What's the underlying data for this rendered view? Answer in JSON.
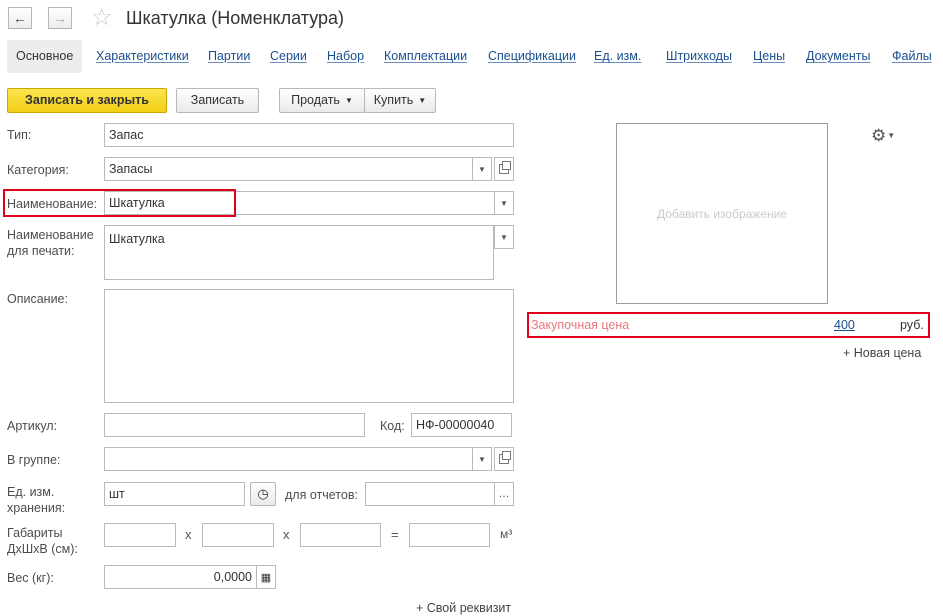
{
  "window": {
    "title": "Шкатулка (Номенклатура)"
  },
  "nav": {
    "back_icon": "←",
    "forward_icon": "→",
    "star_icon": "☆"
  },
  "tabs": [
    "Основное",
    "Характеристики",
    "Партии",
    "Серии",
    "Набор",
    "Комплектации",
    "Спецификации",
    "Ед. изм.",
    "Штрихкоды",
    "Цены",
    "Документы",
    "Файлы"
  ],
  "toolbar": {
    "save_close": "Записать и закрыть",
    "save": "Записать",
    "sell": "Продать",
    "buy": "Купить"
  },
  "form": {
    "type_label": "Тип:",
    "type_value": "Запас",
    "category_label": "Категория:",
    "category_value": "Запасы",
    "name_label": "Наименование:",
    "name_value": "Шкатулка",
    "print_name_label_1": "Наименование",
    "print_name_label_2": "для печати:",
    "print_name_value": "Шкатулка",
    "description_label": "Описание:",
    "description_value": "",
    "article_label": "Артикул:",
    "article_value": "",
    "code_label": "Код:",
    "code_value": "НФ-00000040",
    "group_label": "В группе:",
    "group_value": "",
    "unit_label_1": "Ед. изм.",
    "unit_label_2": "хранения:",
    "unit_value": "шт",
    "reports_label": "для отчетов:",
    "reports_value": "",
    "dims_label_1": "Габариты",
    "dims_label_2": "ДхШхВ (см):",
    "x_symbol": "x",
    "eq_symbol": "=",
    "m3_unit": "м³",
    "weight_label": "Вес (кг):",
    "weight_value": "0,0000",
    "custom_attr_link": "+ Свой реквизит"
  },
  "right_panel": {
    "add_image": "Добавить изображение",
    "purchase_price_label": "Закупочная цена",
    "purchase_price_value": "400",
    "currency": "руб.",
    "new_price_link": "+ Новая цена"
  },
  "colors": {
    "highlight": "#e3001b",
    "primary_button": "#f5d52a",
    "link": "#1a4f8f",
    "purchase_price_label": "#e8787f"
  }
}
